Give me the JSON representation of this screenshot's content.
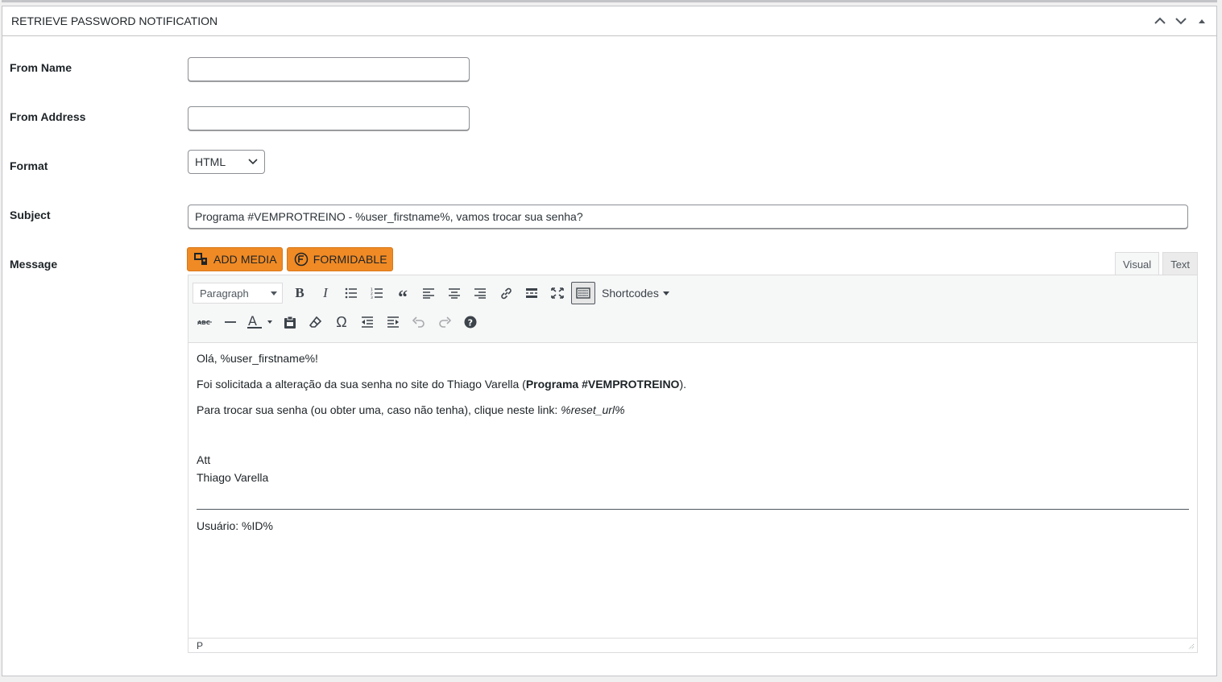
{
  "panel": {
    "title": "RETRIEVE PASSWORD NOTIFICATION",
    "controls": [
      "chevron-up-icon",
      "chevron-down-icon",
      "triangle-up-icon"
    ]
  },
  "fields": {
    "from_name": {
      "label": "From Name",
      "value": ""
    },
    "from_address": {
      "label": "From Address",
      "value": ""
    },
    "format": {
      "label": "Format",
      "value": "HTML"
    },
    "subject": {
      "label": "Subject",
      "value": "Programa #VEMPROTREINO - %user_firstname%, vamos trocar sua senha?"
    },
    "message": {
      "label": "Message"
    }
  },
  "media_buttons": {
    "add_media": "ADD MEDIA",
    "formidable": "FORMIDABLE"
  },
  "tabs": {
    "visual": "Visual",
    "text": "Text"
  },
  "toolbar": {
    "paragraph": "Paragraph",
    "shortcodes": "Shortcodes"
  },
  "content": {
    "greeting": "Olá, %user_firstname%!",
    "line1_pre": "Foi solicitada a alteração da sua senha no site do Thiago Varella (",
    "line1_bold": "Programa #VEMPROTREINO",
    "line1_post": ").",
    "line2_pre": "Para trocar sua senha (ou obter uma, caso não tenha), clique neste link: ",
    "line2_link": "%reset_url%",
    "sign1": "Att",
    "sign2": "Thiago Varella",
    "footer": "Usuário: %ID%"
  },
  "statusbar": {
    "path": "P"
  },
  "colors": {
    "accent": "#f08a24",
    "border": "#c3c4c7"
  }
}
